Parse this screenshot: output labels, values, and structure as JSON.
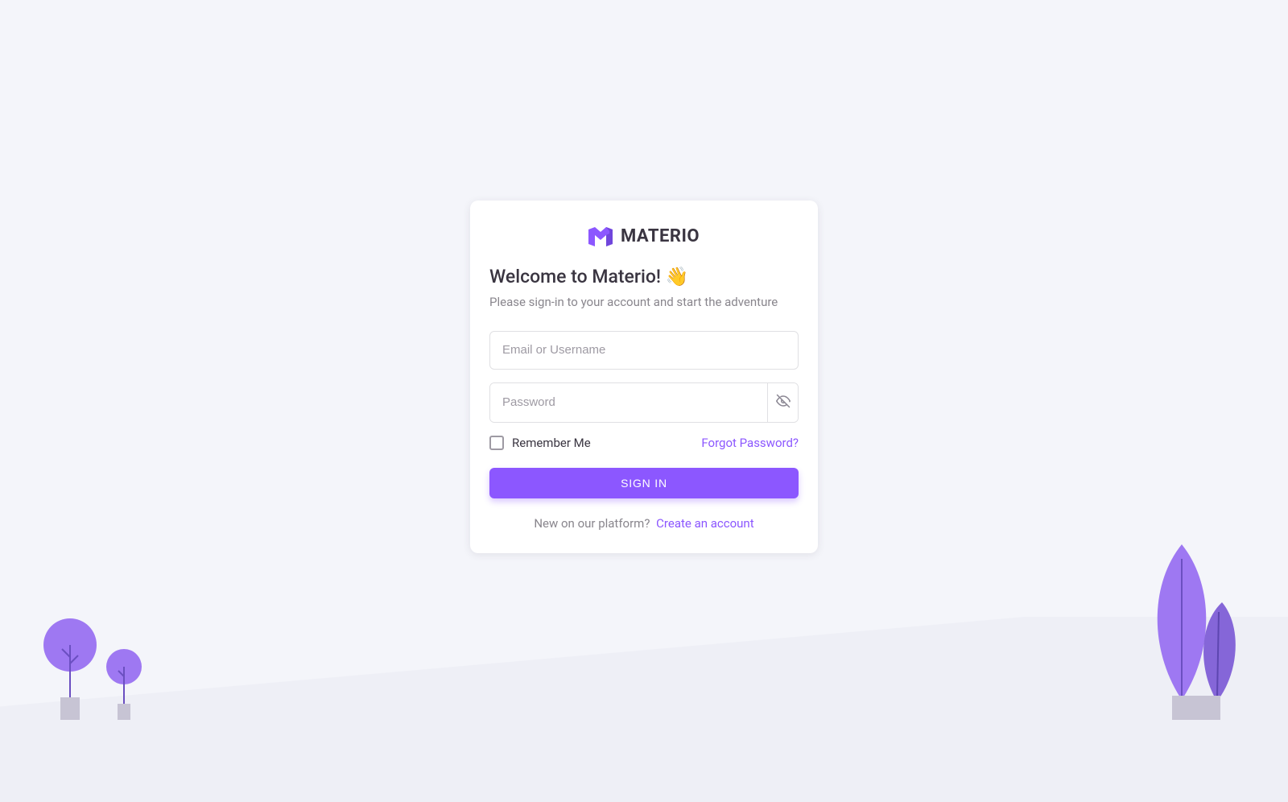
{
  "brand": {
    "name": "Materio"
  },
  "headings": {
    "title": "Welcome to Materio! 👋",
    "subtitle": "Please sign-in to your account and start the adventure"
  },
  "fields": {
    "email": {
      "placeholder": "Email or Username",
      "value": ""
    },
    "password": {
      "placeholder": "Password",
      "value": ""
    }
  },
  "remember": {
    "label": "Remember Me",
    "checked": false
  },
  "links": {
    "forgot": "Forgot Password?",
    "create": "Create an account"
  },
  "buttons": {
    "signin": "Sign In"
  },
  "footer": {
    "prompt": "New on our platform?"
  },
  "colors": {
    "primary": "#8c57ff",
    "text": "#3a3541",
    "muted": "#89868D",
    "border": "#e0e0e3",
    "page_bg": "#f4f5fa",
    "card_bg": "#ffffff"
  }
}
